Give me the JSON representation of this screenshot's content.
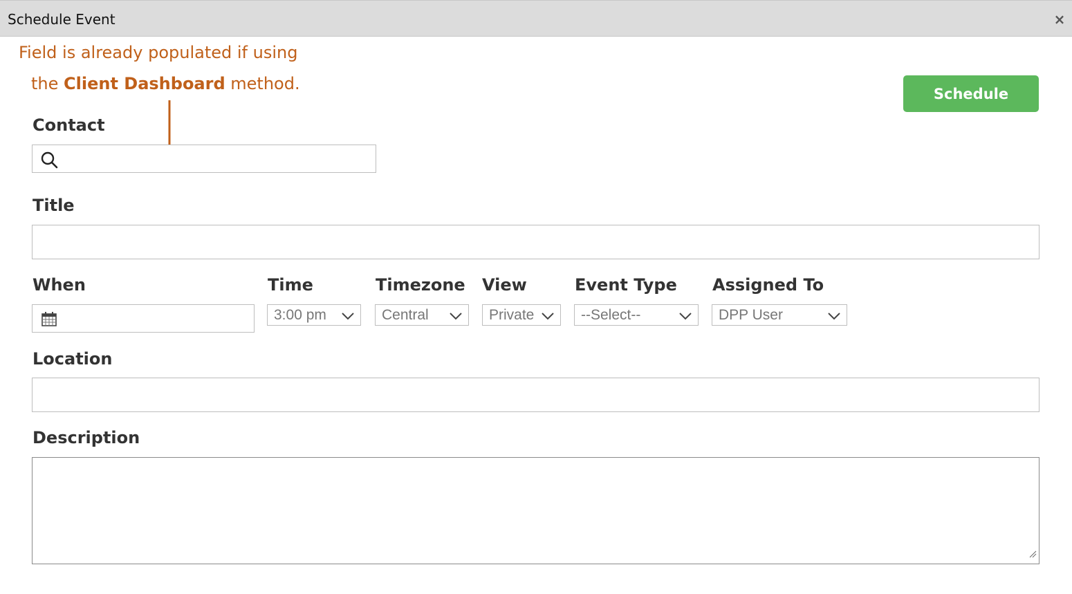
{
  "dialog": {
    "title": "Schedule Event",
    "close_label": "×"
  },
  "callout": {
    "line1": "Field is already populated if using",
    "line2_prefix": "the ",
    "line2_bold": "Client Dashboard",
    "line2_suffix": " method.",
    "color": "#c0601a"
  },
  "actions": {
    "schedule_label": "Schedule",
    "schedule_color": "#5cb85c"
  },
  "fields": {
    "contact": {
      "label": "Contact",
      "value": "",
      "placeholder": ""
    },
    "title": {
      "label": "Title",
      "value": ""
    },
    "when": {
      "label": "When",
      "value": ""
    },
    "time": {
      "label": "Time",
      "selected": "3:00 pm"
    },
    "timezone": {
      "label": "Timezone",
      "selected": "Central"
    },
    "view": {
      "label": "View",
      "selected": "Private"
    },
    "event_type": {
      "label": "Event Type",
      "selected": "--Select--"
    },
    "assigned_to": {
      "label": "Assigned To",
      "selected": "DPP User"
    },
    "location": {
      "label": "Location",
      "value": ""
    },
    "description": {
      "label": "Description",
      "value": ""
    }
  },
  "icons": {
    "contact_icon": "search-icon",
    "when_icon": "calendar-icon",
    "select_icon": "chevron-down-icon"
  }
}
